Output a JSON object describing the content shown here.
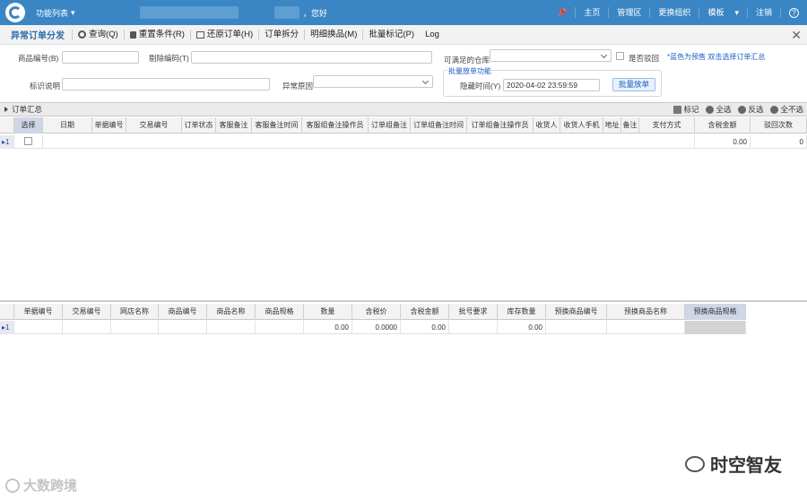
{
  "topbar": {
    "func_menu": "功能列表",
    "greeting": "，您好",
    "nav": [
      "主页",
      "管理区",
      "更换组织",
      "模板",
      "注销",
      "?"
    ]
  },
  "toolbar": {
    "title": "异常订单分发",
    "buttons": [
      "查询(Q)",
      "重置条件(R)",
      "还原订单(H)",
      "订单拆分",
      "明细换品(M)",
      "批量标记(P)",
      "Log"
    ],
    "close": "✕"
  },
  "form": {
    "product_code_label": "商品编号(B)",
    "exclude_code_label": "剔除编码(T)",
    "warehouse_label": "可满足的仓库",
    "rejected_label": "是否驳回",
    "hint": "*蓝色为预售 双击选择订单汇总",
    "remark_label": "标识说明",
    "abnormal_reason_label": "异常原因",
    "batch_group_legend": "批量放单功能",
    "hide_time_label": "隐藏时间(Y)",
    "hide_time_value": "2020-04-02 23:59:59",
    "batch_release_button": "批量放单"
  },
  "summary_panel": {
    "title": "订单汇总",
    "actions": [
      "标记",
      "全选",
      "反选",
      "全不选"
    ],
    "columns": [
      "选择",
      "日期",
      "单据编号",
      "交易编号",
      "订单状态",
      "客服备注",
      "客服备注时间",
      "客服组备注操作员",
      "订单组备注",
      "订单组备注时间",
      "订单组备注操作员",
      "收货人",
      "收货人手机",
      "地址",
      "备注",
      "支付方式",
      "含税金额",
      "驳回次数"
    ],
    "row": {
      "index": "1",
      "amount": "0.00",
      "reject_count": "0"
    }
  },
  "detail_grid": {
    "columns": [
      "单据编号",
      "交易编号",
      "网店名称",
      "商品编号",
      "商品名称",
      "商品规格",
      "数量",
      "含税价",
      "含税金额",
      "批号要求",
      "库存数量",
      "预换商品编号",
      "预换商品名称",
      "预换商品规格"
    ],
    "row": {
      "index": "1",
      "qty": "0.00",
      "price": "0.0000",
      "amount": "0.00",
      "stock": "0.00"
    }
  },
  "watermarks": {
    "left": "大数跨境",
    "right": "时空智友"
  }
}
